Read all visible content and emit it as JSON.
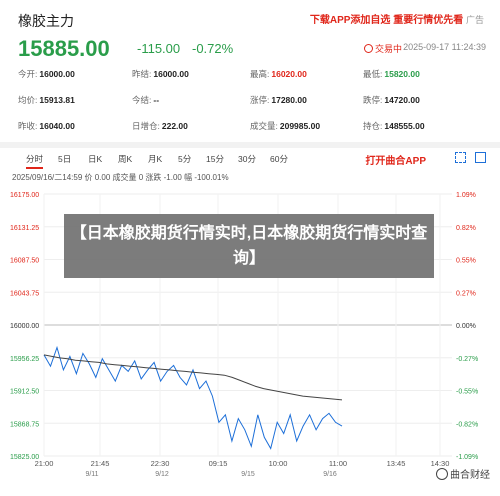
{
  "header": {
    "title": "橡胶主力",
    "promo_red": "下载APP添加自选 重要行情优先看",
    "promo_grey": "广告"
  },
  "quote": {
    "price": "15885.00",
    "change": "-115.00",
    "change_pct": "-0.72%",
    "status": "交易中",
    "time": "2025-09-17 11:24:39"
  },
  "stats": [
    [
      {
        "label": "今开:",
        "value": "16000.00",
        "tone": ""
      },
      {
        "label": "昨结:",
        "value": "16000.00",
        "tone": ""
      },
      {
        "label": "最高:",
        "value": "16020.00",
        "tone": "red"
      },
      {
        "label": "最低:",
        "value": "15820.00",
        "tone": "green"
      }
    ],
    [
      {
        "label": "均价:",
        "value": "15913.81",
        "tone": ""
      },
      {
        "label": "today_change_label",
        "value": "",
        "tone": ""
      },
      {
        "label": "涨停:",
        "value": "17280.00",
        "tone": ""
      },
      {
        "label": "跌停:",
        "value": "14720.00",
        "tone": ""
      }
    ],
    [
      {
        "label": "昨收:",
        "value": "16040.00",
        "tone": ""
      },
      {
        "label": "日增仓:",
        "value": "222.00",
        "tone": ""
      },
      {
        "label": "成交量:",
        "value": "209985.00",
        "tone": ""
      },
      {
        "label": "持仓:",
        "value": "148555.00",
        "tone": ""
      }
    ]
  ],
  "stats_mid": {
    "label": "今结:",
    "value": "--"
  },
  "tabs": [
    "分时",
    "5日",
    "日K",
    "周K",
    "月K",
    "5分",
    "15分",
    "30分",
    "60分"
  ],
  "open_app": "打开曲合APP",
  "chart_info": "2025/09/16/二14:59 价 0.00 成交量 0 涨跌 -1.00 幅 -100.01%",
  "overlay_text": "【日本橡胶期货行情实时,日本橡胶期货行情实时查询】",
  "watermark": "曲合财经",
  "chart_data": {
    "type": "line",
    "title": "",
    "xlabel": "",
    "ylabel": "",
    "y_ticks": [
      "16175.00",
      "16131.25",
      "16087.50",
      "16043.75",
      "16000.00",
      "15956.25",
      "15912.50",
      "15868.75",
      "15825.00"
    ],
    "pct_ticks": [
      "1.09%",
      "0.82%",
      "0.55%",
      "0.27%",
      "0.00%",
      "-0.27%",
      "-0.55%",
      "-0.82%",
      "-1.09%"
    ],
    "x_ticks": [
      "21:00",
      "21:45",
      "22:30",
      "09:15",
      "10:00",
      "11:00",
      "13:45",
      "14:30"
    ],
    "date_ticks": [
      "9/11",
      "9/12",
      "9/15",
      "9/16"
    ],
    "ylim": [
      15825,
      16175
    ],
    "series": [
      {
        "values": [
          15960,
          15945,
          15970,
          15940,
          15958,
          15935,
          15962,
          15948,
          15930,
          15955,
          15940,
          15925,
          15946,
          15938,
          15952,
          15928,
          15940,
          15950,
          15925,
          15938,
          15946,
          15930,
          15920,
          15940,
          15915,
          15925,
          15905,
          15870,
          15880,
          15845,
          15875,
          15860,
          15838,
          15880,
          15850,
          15835,
          15870,
          15855,
          15880,
          15845,
          15865,
          15880,
          15860,
          15875,
          15882,
          15870,
          15865
        ]
      },
      {
        "values": [
          15960,
          15958,
          15956,
          15955,
          15953,
          15952,
          15951,
          15950,
          15948,
          15947,
          15946,
          15945,
          15944,
          15943,
          15942,
          15941,
          15940,
          15939,
          15938,
          15937,
          15936,
          15935,
          15934,
          15933,
          15930,
          15926,
          15922,
          15918,
          15915,
          15913,
          15911,
          15909,
          15907,
          15905,
          15904,
          15903,
          15902,
          15901,
          15900
        ]
      }
    ]
  }
}
